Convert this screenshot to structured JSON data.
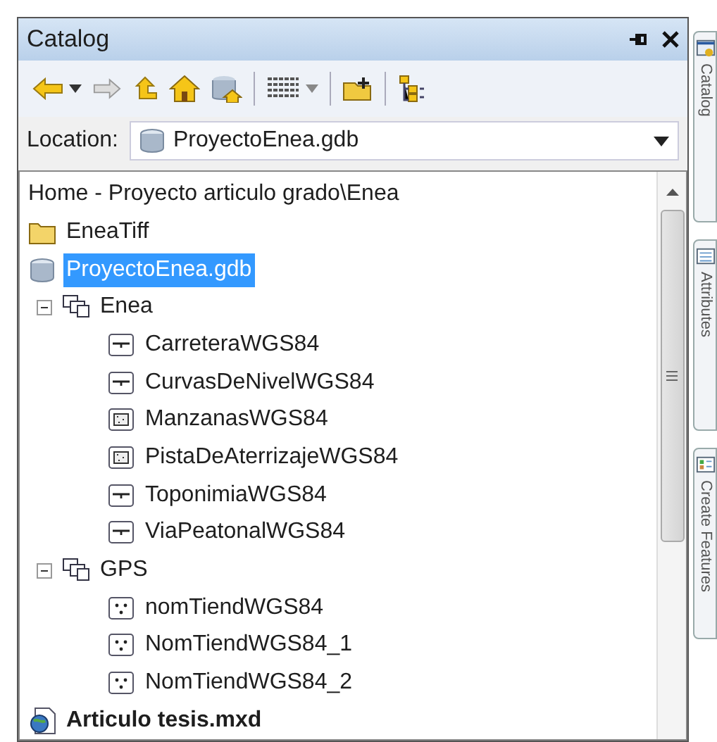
{
  "window": {
    "title": "Catalog"
  },
  "location": {
    "label": "Location:",
    "value": "ProyectoEnea.gdb"
  },
  "tree": {
    "header": "Home - Proyecto articulo grado\\Enea",
    "items": [
      {
        "kind": "folder",
        "label": "EneaTiff",
        "selected": false
      },
      {
        "kind": "gdb",
        "label": "ProyectoEnea.gdb",
        "selected": true
      },
      {
        "kind": "dataset",
        "label": "Enea",
        "selected": false,
        "expanded": true,
        "children": [
          {
            "kind": "line",
            "label": "CarreteraWGS84",
            "selected": false
          },
          {
            "kind": "line",
            "label": "CurvasDeNivelWGS84",
            "selected": false
          },
          {
            "kind": "polygon",
            "label": "ManzanasWGS84",
            "selected": false
          },
          {
            "kind": "polygon",
            "label": "PistaDeAterrizajeWGS84",
            "selected": false
          },
          {
            "kind": "line",
            "label": "ToponimiaWGS84",
            "selected": false
          },
          {
            "kind": "line",
            "label": "ViaPeatonalWGS84",
            "selected": false
          }
        ]
      },
      {
        "kind": "dataset",
        "label": "GPS",
        "selected": false,
        "expanded": true,
        "children": [
          {
            "kind": "point",
            "label": "nomTiendWGS84",
            "selected": false
          },
          {
            "kind": "point",
            "label": "NomTiendWGS84_1",
            "selected": false
          },
          {
            "kind": "point",
            "label": "NomTiendWGS84_2",
            "selected": false
          }
        ]
      },
      {
        "kind": "mxd",
        "label": "Articulo tesis.mxd",
        "selected": false
      }
    ]
  },
  "side_tabs": [
    {
      "label": "Catalog"
    },
    {
      "label": "Attributes"
    },
    {
      "label": "Create Features"
    }
  ]
}
